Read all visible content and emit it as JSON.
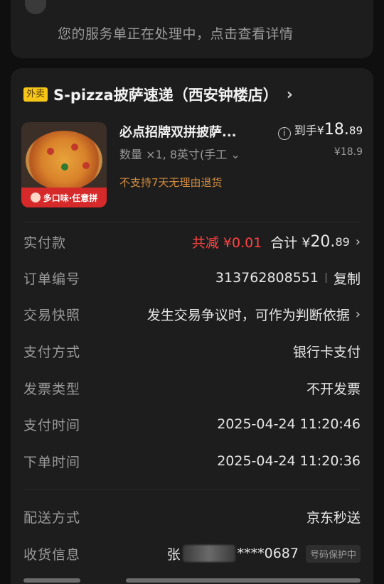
{
  "service_card": {
    "text": "您的服务单正在处理中，点击查看详情"
  },
  "store": {
    "tag": "外卖",
    "name": "S-pizza披萨速递（西安钟楼店）",
    "chevron": "›"
  },
  "product": {
    "title": "必点招牌双拼披萨...",
    "spec": "数量 ×1, 8英寸(手工 ⌄",
    "note": "不支持7天无理由退货",
    "image_banner": "多口味·任意拼",
    "price_label": "到手",
    "price_currency": "¥",
    "price_int": "18.",
    "price_dec": "89",
    "original_price": "¥18.9"
  },
  "order": {
    "rows": [
      {
        "label": "实付款",
        "discount": "共减 ¥0.01",
        "total_prefix": "合计 ¥",
        "total_int": "20.",
        "total_dec": "89"
      },
      {
        "label": "订单编号",
        "value": "313762808551",
        "action": "复制"
      },
      {
        "label": "交易快照",
        "value": "发生交易争议时，可作为判断依据"
      },
      {
        "label": "支付方式",
        "value": "银行卡支付"
      },
      {
        "label": "发票类型",
        "value": "不开发票"
      },
      {
        "label": "支付时间",
        "value": "2025-04-24 11:20:46"
      },
      {
        "label": "下单时间",
        "value": "2025-04-24 11:20:36"
      },
      {
        "label": "配送方式",
        "value": "京东秒送"
      },
      {
        "label": "收货信息",
        "name_prefix": "张",
        "phone": "****0687",
        "badge": "号码保护中"
      }
    ]
  },
  "colors": {
    "background": "#0f0f0f",
    "card": "#1d1d1d",
    "accent_red": "#ff4343",
    "tag_yellow": "#f5c518",
    "note_orange": "#d08a3e"
  }
}
